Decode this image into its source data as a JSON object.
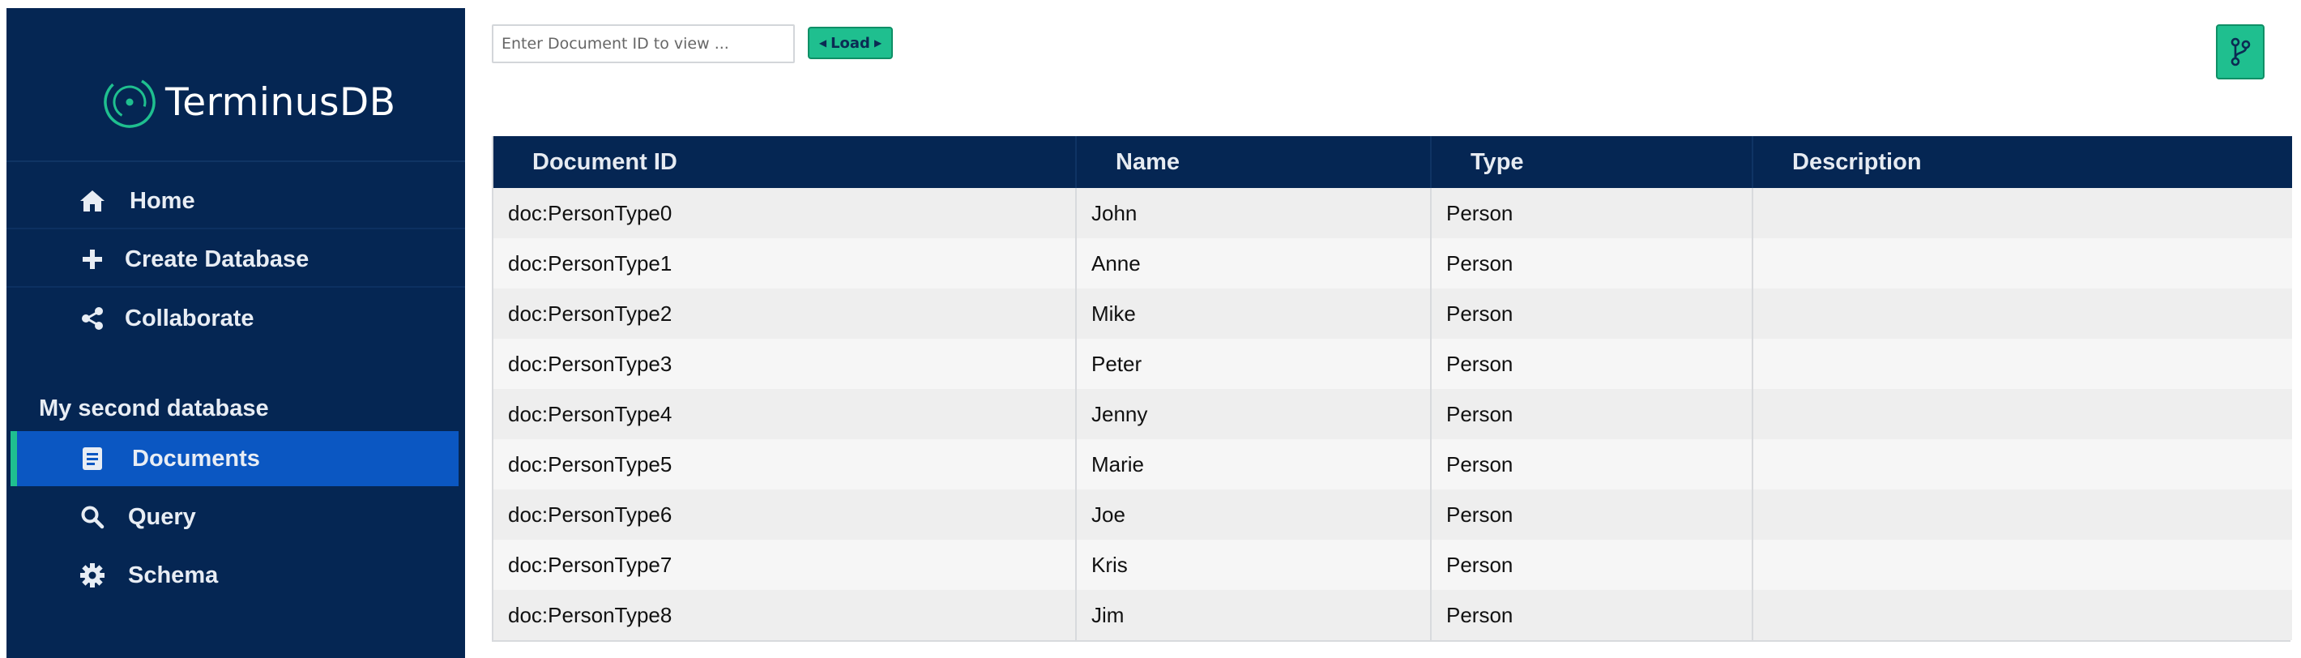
{
  "sidebar": {
    "logo_text": "TerminusDB",
    "nav": [
      {
        "label": "Home",
        "icon": "home-icon"
      },
      {
        "label": "Create Database",
        "icon": "plus-icon"
      },
      {
        "label": "Collaborate",
        "icon": "share-icon"
      }
    ],
    "section_title": "My second database",
    "db_nav": [
      {
        "label": "Documents",
        "icon": "document-icon",
        "active": true
      },
      {
        "label": "Query",
        "icon": "search-icon",
        "active": false
      },
      {
        "label": "Schema",
        "icon": "gear-icon",
        "active": false
      }
    ]
  },
  "toolbar": {
    "doc_id_placeholder": "Enter Document ID to view ...",
    "load_label": "Load",
    "branch_icon": "branch-icon"
  },
  "table": {
    "columns": [
      "Document ID",
      "Name",
      "Type",
      "Description"
    ],
    "rows": [
      [
        "doc:PersonType0",
        "John",
        "Person",
        ""
      ],
      [
        "doc:PersonType1",
        "Anne",
        "Person",
        ""
      ],
      [
        "doc:PersonType2",
        "Mike",
        "Person",
        ""
      ],
      [
        "doc:PersonType3",
        "Peter",
        "Person",
        ""
      ],
      [
        "doc:PersonType4",
        "Jenny",
        "Person",
        ""
      ],
      [
        "doc:PersonType5",
        "Marie",
        "Person",
        ""
      ],
      [
        "doc:PersonType6",
        "Joe",
        "Person",
        ""
      ],
      [
        "doc:PersonType7",
        "Kris",
        "Person",
        ""
      ],
      [
        "doc:PersonType8",
        "Jim",
        "Person",
        ""
      ]
    ]
  },
  "colors": {
    "sidebar_bg": "#052653",
    "active_bg": "#0b57c2",
    "accent": "#1fbf8f"
  }
}
